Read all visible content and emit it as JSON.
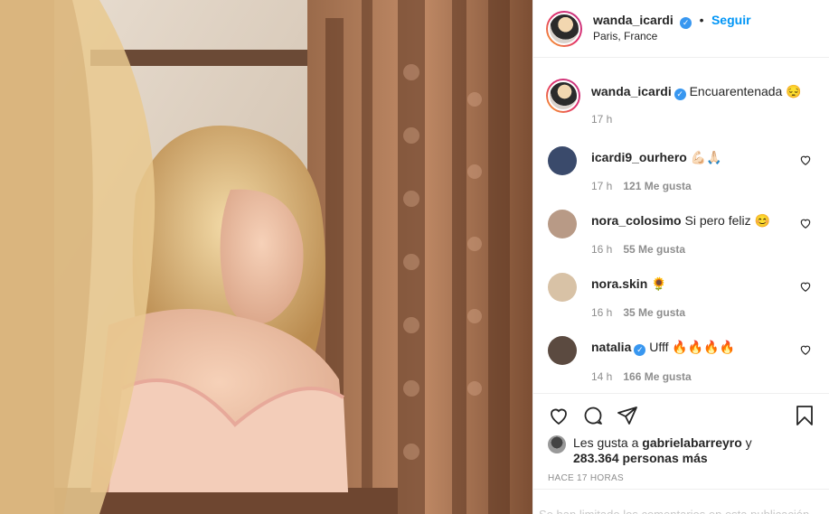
{
  "post": {
    "author": "wanda_icardi",
    "follow_label": "Seguir",
    "location": "Paris, France",
    "verified_badge": "✓",
    "dot": "•"
  },
  "caption": {
    "author": "wanda_icardi",
    "text": "Encuarentenada",
    "emoji": "😔",
    "time": "17 h"
  },
  "comments": [
    {
      "user": "icardi9_ourhero",
      "verified": false,
      "text": "💪🏻🙏🏻",
      "time": "17 h",
      "likes": "121 Me gusta",
      "avatar_color": "#3a4a6b"
    },
    {
      "user": "nora_colosimo",
      "verified": false,
      "text": "Si pero feliz 😊",
      "time": "16 h",
      "likes": "55 Me gusta",
      "avatar_color": "#b89a86"
    },
    {
      "user": "nora.skin",
      "verified": false,
      "text": "🌻",
      "time": "16 h",
      "likes": "35 Me gusta",
      "avatar_color": "#d8c2a6"
    },
    {
      "user": "natalia",
      "verified": true,
      "text": "Ufff 🔥🔥🔥🔥",
      "time": "14 h",
      "likes": "166 Me gusta",
      "avatar_color": "#5b4a40"
    }
  ],
  "icons": {
    "like": "heart-icon",
    "comment": "comment-icon",
    "share": "share-icon",
    "save": "bookmark-icon"
  },
  "likes_line": {
    "prefix": "Les gusta a ",
    "user": "gabrielabarreyro",
    "middle": " y",
    "count": "283.364 personas más"
  },
  "timestamp": "HACE 17 HORAS",
  "comments_closed": "Se han limitado los comentarios en esta publicación"
}
